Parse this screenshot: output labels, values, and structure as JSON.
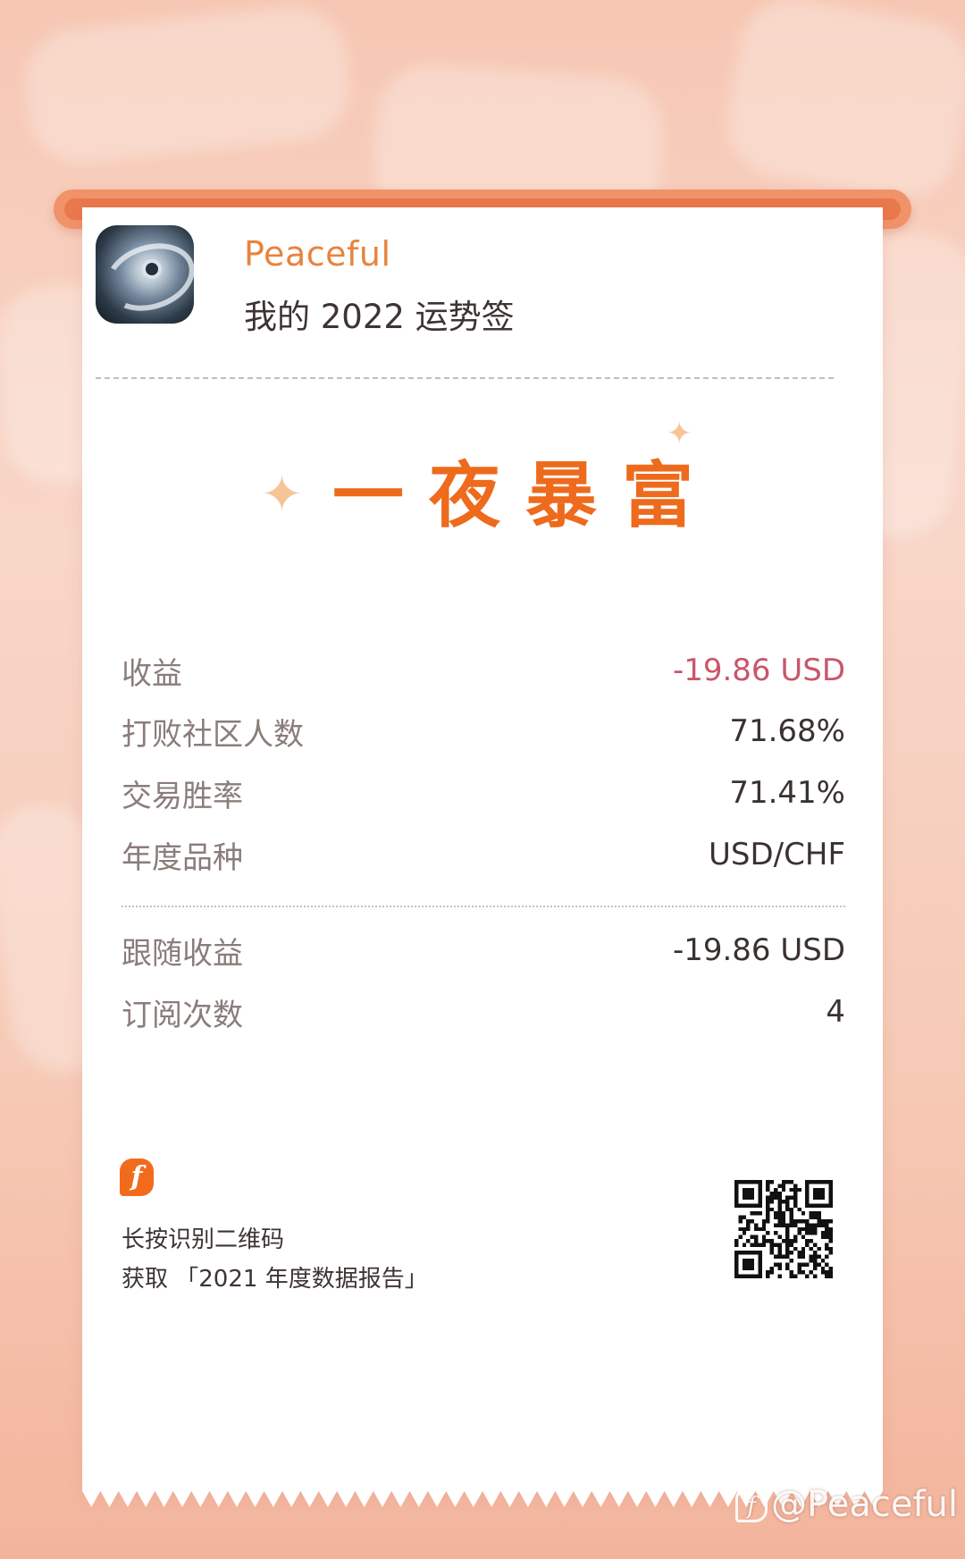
{
  "header": {
    "username": "Peaceful",
    "subtitle": "我的 2022 运势签"
  },
  "fortune": {
    "title": "一夜暴富"
  },
  "stats": [
    {
      "label": "收益",
      "value": "-19.86 USD",
      "negative": true
    },
    {
      "label": "打败社区人数",
      "value": "71.68%"
    },
    {
      "label": "交易胜率",
      "value": "71.41%"
    },
    {
      "label": "年度品种",
      "value": "USD/CHF"
    },
    {
      "label": "跟随收益",
      "value": "-19.86 USD"
    },
    {
      "label": "订阅次数",
      "value": "4"
    }
  ],
  "footer": {
    "brand_glyph": "f",
    "qr_line1": "长按识别二维码",
    "qr_line2": "获取 「2021 年度数据报告」"
  },
  "watermark": {
    "text": "@Peaceful"
  },
  "colors": {
    "accent": "#ee6a1c",
    "username": "#e7843e",
    "negative": "#c9566a",
    "printer_bar": "#f0926a"
  }
}
